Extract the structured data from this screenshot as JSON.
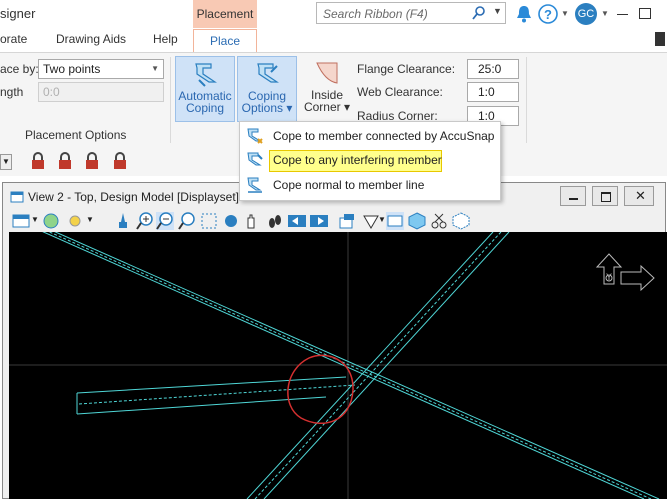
{
  "app": {
    "title_fragment": "signer",
    "context_tab": "Placement"
  },
  "search": {
    "placeholder": "Search Ribbon (F4)"
  },
  "user": {
    "initials": "GC"
  },
  "tabs": [
    {
      "label": "orate"
    },
    {
      "label": "Drawing Aids"
    },
    {
      "label": "Help"
    },
    {
      "label": "Place"
    }
  ],
  "placement": {
    "place_by_label": "ace by:",
    "place_by_value": "Two points",
    "length_label": "ngth",
    "length_value": "0:0",
    "group_label": "Placement Options"
  },
  "buttons": {
    "auto_coping_line1": "Automatic",
    "auto_coping_line2": "Coping",
    "coping_options_line1": "Coping",
    "coping_options_line2": "Options ▾",
    "inside_corner_line1": "Inside",
    "inside_corner_line2": "Corner ▾"
  },
  "clearances": {
    "flange_label": "Flange Clearance:",
    "flange_value": "25:0",
    "web_label": "Web Clearance:",
    "web_value": "1:0",
    "radius_label": "Radius Corner:",
    "radius_value": "1:0"
  },
  "menu": {
    "items": [
      {
        "label": "Cope to member connected by AccuSnap"
      },
      {
        "label": "Cope to any interfering member",
        "highlighted": true
      },
      {
        "label": "Cope normal to member line"
      }
    ]
  },
  "view": {
    "title": "View 2 - Top, Design Model [Displayset]"
  },
  "colors": {
    "accent_blue": "#2b6cb3",
    "context_tab": "#f8c9b4",
    "menu_highlight": "#ffff8c",
    "canvas_bg": "#000000",
    "member_lines": "#4fd6d6",
    "markup_circle": "#d43030"
  }
}
